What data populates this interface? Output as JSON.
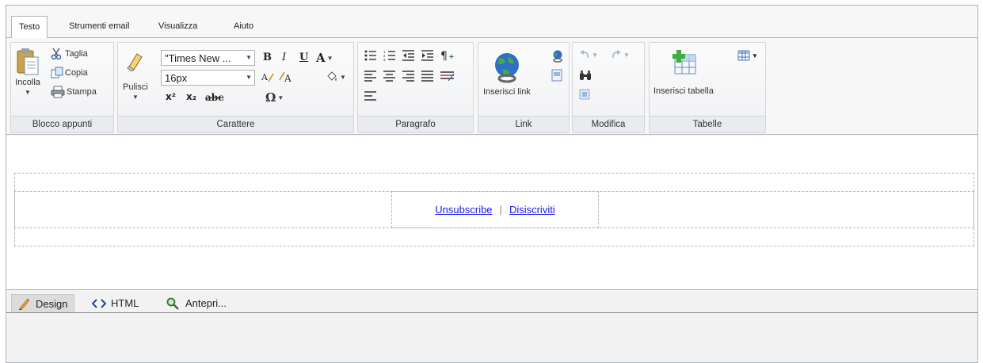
{
  "tabs": [
    {
      "label": "Testo",
      "active": true
    },
    {
      "label": "Strumenti email",
      "active": false
    },
    {
      "label": "Visualizza",
      "active": false
    },
    {
      "label": "Aiuto",
      "active": false
    }
  ],
  "clipboard": {
    "group_label": "Blocco appunti",
    "paste_label": "Incolla",
    "cut_label": "Taglia",
    "copy_label": "Copia",
    "print_label": "Stampa"
  },
  "font": {
    "group_label": "Carattere",
    "clear_label": "Pulisci",
    "font_family_value": "\"Times New ...",
    "font_size_value": "16px",
    "bold": "B",
    "italic": "I",
    "underline": "U",
    "font_color": "A",
    "superscript": "x²",
    "subscript": "x₂",
    "strikethrough": "abc",
    "special_char": "Ω"
  },
  "paragraph": {
    "group_label": "Paragrafo"
  },
  "link": {
    "group_label": "Link",
    "insert_link_label": "Inserisci link"
  },
  "edit": {
    "group_label": "Modifica"
  },
  "tables": {
    "group_label": "Tabelle",
    "insert_table_label": "Inserisci tabella"
  },
  "content": {
    "unsubscribe_label": "Unsubscribe",
    "separator": "|",
    "disiscriviti_label": "Disiscriviti"
  },
  "modes": [
    {
      "label": "Design",
      "active": true
    },
    {
      "label": "HTML",
      "active": false
    },
    {
      "label": "Antepri...",
      "active": false
    }
  ],
  "colors": {
    "link": "#1a1aee",
    "border": "#aeb4bb",
    "ribbon_bg": "#f7f7f7"
  }
}
